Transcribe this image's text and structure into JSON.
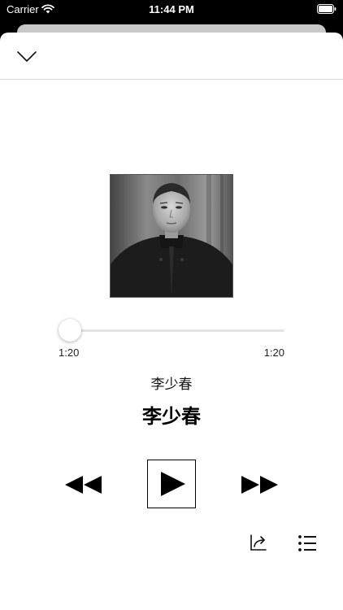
{
  "status_bar": {
    "carrier": "Carrier",
    "time": "11:44 PM"
  },
  "icons": {
    "wifi": "wifi-icon",
    "battery": "battery-icon",
    "dismiss": "chevron-down-icon",
    "rewind": "rewind-icon",
    "play": "play-icon",
    "forward": "fast-forward-icon",
    "share": "share-icon",
    "playlist": "playlist-icon"
  },
  "player": {
    "elapsed": "1:20",
    "total": "1:20",
    "progress_fraction": 0.05,
    "artist": "李少春",
    "title": "李少春"
  },
  "colors": {
    "sheet_background": "#ffffff",
    "status_bar_background": "#000000",
    "track": "#e4e4e4"
  }
}
